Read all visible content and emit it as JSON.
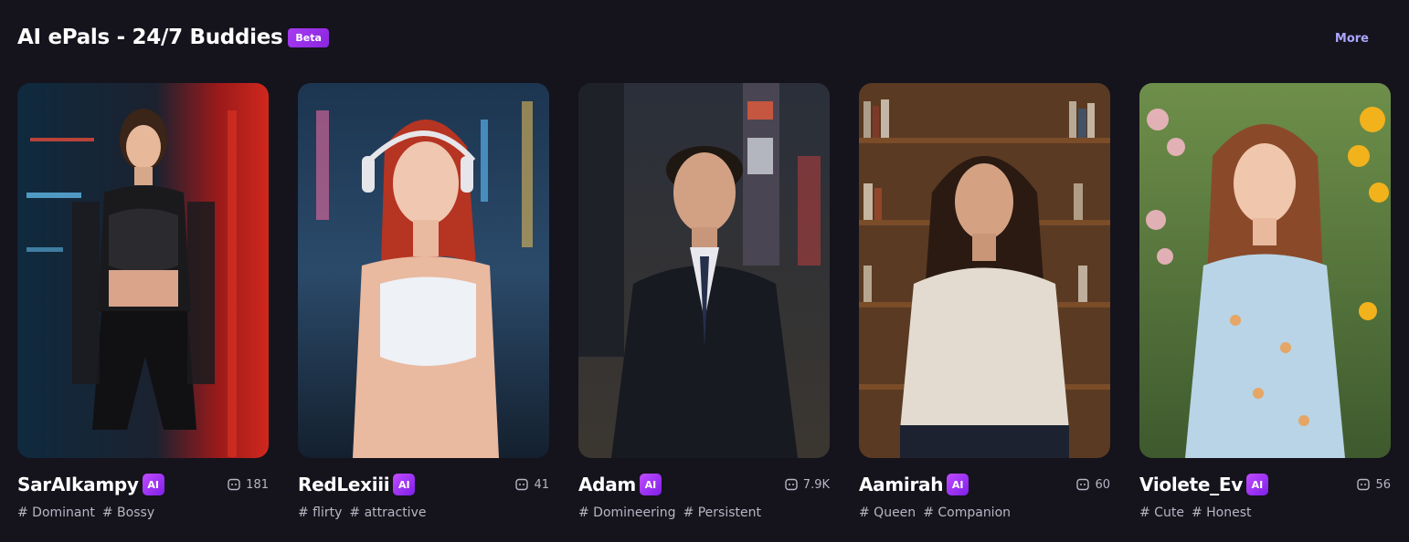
{
  "section": {
    "title": "AI ePals - 24/7 Buddies",
    "badge": "Beta",
    "more_label": "More"
  },
  "cards": [
    {
      "name": "SarAIkampy",
      "ai_badge": "AI",
      "count": "181",
      "tags": [
        "# Dominant",
        "# Bossy"
      ],
      "image_icon": "woman-portrait-image"
    },
    {
      "name": "RedLexiii",
      "ai_badge": "AI",
      "count": "41",
      "tags": [
        "# flirty",
        "# attractive"
      ],
      "image_icon": "woman-headphones-portrait-image"
    },
    {
      "name": "Adam",
      "ai_badge": "AI",
      "count": "7.9K",
      "tags": [
        "# Domineering",
        "# Persistent"
      ],
      "image_icon": "man-suit-portrait-image"
    },
    {
      "name": "Aamirah",
      "ai_badge": "AI",
      "count": "60",
      "tags": [
        "# Queen",
        "# Companion"
      ],
      "image_icon": "woman-bookshelf-portrait-image"
    },
    {
      "name": "Violete_Ev",
      "ai_badge": "AI",
      "count": "56",
      "tags": [
        "# Cute",
        "# Honest"
      ],
      "image_icon": "woman-garden-portrait-image"
    }
  ],
  "colors": {
    "background": "#15131c",
    "accent": "#9b30ff",
    "more_link": "#a9a6ff",
    "muted_text": "#b8b6c4"
  }
}
